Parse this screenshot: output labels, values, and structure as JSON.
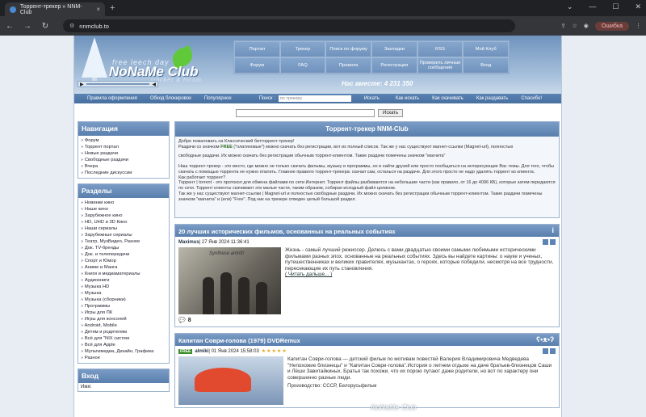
{
  "browser": {
    "tab_title": "Торрент-трекер » NNM-Club",
    "url": "nnmclub.to",
    "error_btn": "Ошибка",
    "new_tab": "+"
  },
  "header": {
    "logo_sub": "free leech day",
    "logo_title": "NoNaMe Club",
    "logo_tracker": "tracker & forum",
    "menu": [
      "Портал",
      "Трекер",
      "Поиск по форуму",
      "Закладки",
      "RSS",
      "Мой Клуб",
      "Форум",
      "FAQ",
      "Правила",
      "Регистрация",
      "Проверить личные сообщения",
      "Вход"
    ],
    "online": "Нас вместе: 4 231 350"
  },
  "subnav": {
    "rules": "Правила оформления",
    "bypass": "Обход блокировок",
    "popular": "Популярное",
    "search_label": "Поиск :",
    "search_placeholder": "по трекеру",
    "search_btn": "Искать",
    "how_find": "Как искать",
    "how_download": "Как скачивать",
    "how_seed": "Как раздавать",
    "thanks": "Спасибо!"
  },
  "search": {
    "button": "Искать"
  },
  "sidebar": {
    "nav_title": "Навигация",
    "nav_items": [
      "Форум",
      "Торрент портал",
      "Новые раздачи",
      "Свободные раздачи",
      "Вчера",
      "Последние дискуссии"
    ],
    "sections_title": "Разделы",
    "sections_items": [
      "Новинки кино",
      "Наше кино",
      "Зарубежное кино",
      "HD, UHD и 3D Кино",
      "Наши сериалы",
      "Зарубежные сериалы",
      "Театр, МузВидео, Разное",
      "Док. TV-бренды",
      "Док. и телепередачи",
      "Спорт и Юмор",
      "Аниме и Манга",
      "Книги и медиаматериалы",
      "Аудиокниги",
      "Музыка HD",
      "Музыка",
      "Музыка (сборники)",
      "Программы",
      "Игры для ПК",
      "Игры для консолей",
      "Android, Mobile",
      "Детям и родителям",
      "Всё для \"NIX систем",
      "Всё для Apple",
      "Мультимедиа, Дизайн, Графика",
      "Разное"
    ],
    "login_title": "Вход",
    "login_label": "Имя:"
  },
  "welcome": {
    "title": "Торрент-трекер NNM-Club",
    "p1": "Добро пожаловать на Классический битторрент-трекер!",
    "p2a": "Раздачи со значком ",
    "free": "FREE",
    "p2b": " (\"платиновые\") можно скачать без регистрации, вот их полный список. Так же у нас существуют магнет-ссылки (Magnet-url), полностью",
    "p3": "свободные раздачи. Их можно скачать без регистрации обычным торрент-клиентом. Такие раздачи помечены значком \"магнита\"",
    "p4": "Наш торрент-трекер - это место, где можно не только скачать фильмы, музыку и программы, но и найти друзей или просто пообщаться на интересующие Вас темы. Для того, чтобы скачать с помощью торрента не нужно платить. Главное правило торрент-трекера: скачал сам, останься на раздаче. Для этого просто не надо удалять торрент из клиента.",
    "p5": "Как работает торрент?",
    "p6": "Торрент | torrent - это протокол для обмена файлами по сети Интернет. Торрент файлы разбиваются на небольшие части (как правило, от 16 до 4096 КБ), которые затем передаются по сети. Торрент клиенты скачивают эти малые части, таким образом, собирая исходный файл целиком.",
    "p7": "Так же у нас существуют магнет-ссылки | Magnet-url и полностью свободные раздачи. Их можно скачать без регистрации обычным торрент-клиентом. Такие раздачи помечены значком \"магнита\" и (или) \"Free\". Под ник на трекере отведен целый большой раздел."
  },
  "posts": [
    {
      "title": "20 лучших исторических фильмов, основанных на реальных событиях",
      "author": "Maximus",
      "date": " | 27 Янв 2024 11:36:41",
      "thumb_text": "Synthese antritt!",
      "text": "Жизнь - самый лучший режиссер. Делюсь с вами двадцатью своими самыми любимыми историческими фильмами разных эпох, основанные на реальных событиях. Здесь вы найдете картины: о науке и ученых, путешественниках и великих правителях, музыкантах, о героях, которые победили, несмотря на все трудности, пересекающие их путь становления.",
      "more": "( Читать дальше... )",
      "comments": "8"
    },
    {
      "title": "Капитан Соври-голова (1979) DVDRemux",
      "free": "FREE",
      "author": "almiki",
      "date": " | 01 Янв 2024 15:58:03",
      "stars": "★★★★★",
      "text": "Капитан Соври-голова — детский фильм по мотивам повестей Валерия Владимировича Медведева \"Непохожие близнецы\" и \"Капитан Соври-голова\".История о летнем отдыхе на даче братьев-близнецов Саши и Лёши Завитайкиных. Братья так похожи, что их порою путают даже родители, но вот по характеру они совершенно разные люди.",
      "production": "Производство: СССР, Белорусьфильм"
    }
  ],
  "watermark": "NoNaMe Club"
}
